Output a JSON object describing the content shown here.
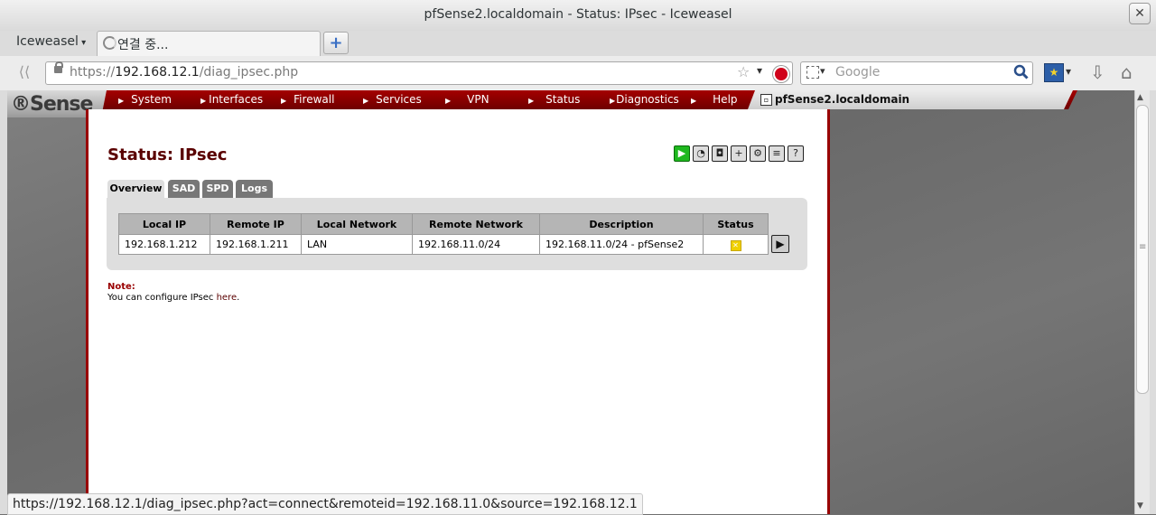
{
  "window": {
    "title": "pfSense2.localdomain - Status: IPsec - Iceweasel",
    "close_glyph": "✕"
  },
  "browser": {
    "app_menu": "Iceweasel",
    "tab_label": "연결 중...",
    "newtab_glyph": "+",
    "url": {
      "prefix": "https://",
      "host": "192.168.12.1",
      "path": "/diag_ipsec.php"
    },
    "search_placeholder": "Google",
    "status_url": "https://192.168.12.1/diag_ipsec.php?act=connect&remoteid=192.168.11.0&source=192.168.12.1"
  },
  "pfsense": {
    "logo": "Sense",
    "nav": [
      "System",
      "Interfaces",
      "Firewall",
      "Services",
      "VPN",
      "Status",
      "Diagnostics",
      "Help"
    ],
    "hostname": "pfSense2.localdomain"
  },
  "page": {
    "title": "Status: IPsec",
    "tabs": [
      "Overview",
      "SAD",
      "SPD",
      "Logs"
    ],
    "active_tab": "Overview",
    "table": {
      "headers": [
        "Local IP",
        "Remote IP",
        "Local Network",
        "Remote Network",
        "Description",
        "Status"
      ],
      "rows": [
        [
          "192.168.1.212",
          "192.168.1.211",
          "LAN",
          "192.168.11.0/24",
          "192.168.11.0/24 - pfSense2"
        ]
      ],
      "status_icon": "status-down-icon"
    },
    "note": {
      "label": "Note:",
      "text": "You can configure IPsec ",
      "link": "here",
      "suffix": "."
    }
  },
  "colors": {
    "pf_red": "#990000",
    "title_red": "#5a0000",
    "status_yellow": "#f0d000"
  }
}
